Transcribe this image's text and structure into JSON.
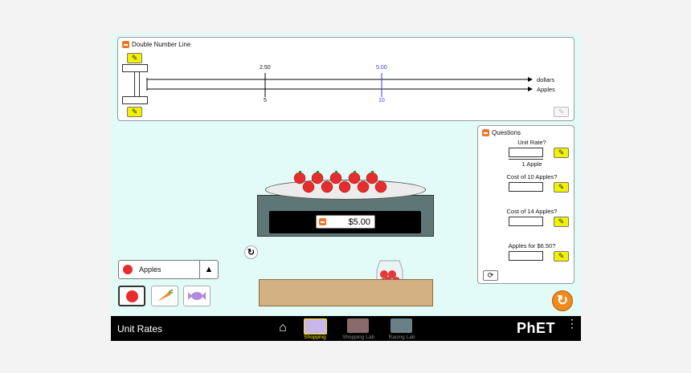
{
  "number_line": {
    "title": "Double Number Line",
    "top_axis_label": "dollars",
    "bottom_axis_label": "Apples",
    "marker1_top": "2.50",
    "marker1_bottom": "5",
    "marker2_top": "5.00",
    "marker2_bottom": "10",
    "marker2_color": "#3b3bff"
  },
  "questions": {
    "title": "Questions",
    "unit_rate_label": "Unit Rate?",
    "unit_rate_denominator": "1 Apple",
    "q1": "Cost of 10 Apples?",
    "q2": "Cost of 14 Apples?",
    "q3": "Apples for $6.50?"
  },
  "scale": {
    "price": "$5.00"
  },
  "selector": {
    "selected": "Apples"
  },
  "navbar": {
    "title": "Unit Rates",
    "tabs": [
      "Shopping",
      "Shopping Lab",
      "Racing Lab"
    ],
    "active_color": "#ffea00",
    "brand": "PhET"
  },
  "colors": {
    "accent": "#e9762b",
    "edit_button": "#f2f200",
    "background": "#e2fbf7"
  }
}
